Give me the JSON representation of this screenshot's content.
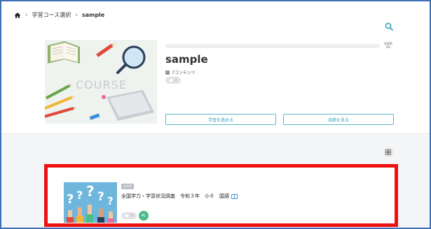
{
  "breadcrumb": {
    "home_icon": "home-icon",
    "items": [
      "学習コース選択",
      "sample"
    ]
  },
  "header": {
    "search_icon": "search-icon"
  },
  "course": {
    "title": "sample",
    "cover_text": "COURSE",
    "contents_count": "7コンテンツ",
    "likes": "1",
    "progress_label": "学習率",
    "progress_value": "0%",
    "progress_fraction": 0.0,
    "study_button": "学習を進める",
    "grade_button": "成績を見る"
  },
  "content": {
    "grid_toggle_icon": "grid-view-icon"
  },
  "card": {
    "badge": "未学習",
    "title": "全国学力・学習状況調査　令和３年　小６　国語",
    "book_icon": "book-icon",
    "likes": "0",
    "lesson_icon": "lesson-type-icon",
    "lesson_label": "AL"
  },
  "colors": {
    "frame_border": "#3d6fb6",
    "accent": "#3aa3bb",
    "highlight": "#ee1111",
    "lesson_green": "#4cbc8a"
  }
}
